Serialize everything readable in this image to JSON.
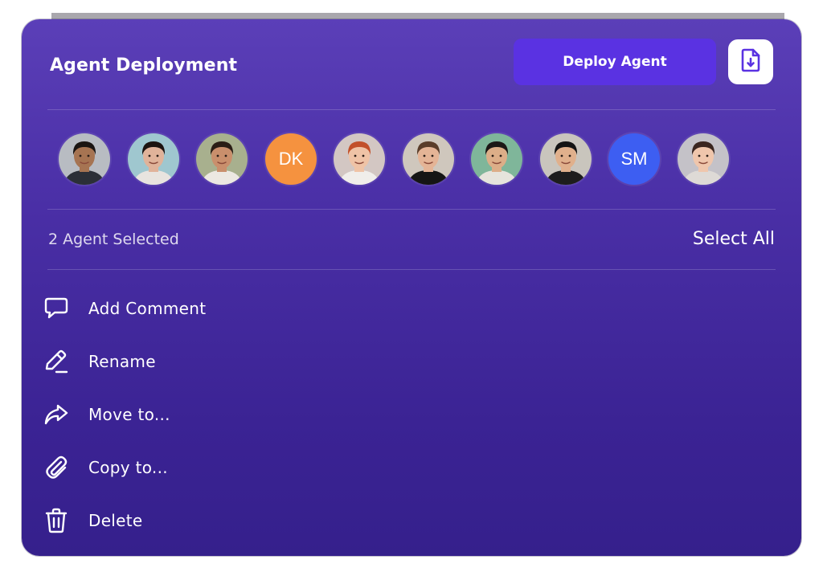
{
  "header": {
    "title": "Agent Deployment",
    "deploy_label": "Deploy Agent",
    "download_icon": "file-download-icon"
  },
  "agents": [
    {
      "type": "photo",
      "name_icon": "agent-avatar-1",
      "skin": "#a67452",
      "hair": "#1a1512",
      "bg": "#b8bcc2",
      "shirt": "#2b2f37"
    },
    {
      "type": "photo",
      "name_icon": "agent-avatar-2",
      "skin": "#e0b39a",
      "hair": "#1c1410",
      "bg": "#9fc7cf",
      "shirt": "#e8e4df"
    },
    {
      "type": "photo",
      "name_icon": "agent-avatar-3",
      "skin": "#c98f6c",
      "hair": "#2a1d15",
      "bg": "#a8b08e",
      "shirt": "#ece8e2"
    },
    {
      "type": "initials",
      "initials": "DK",
      "color": "#f5923f"
    },
    {
      "type": "photo",
      "name_icon": "agent-avatar-5",
      "skin": "#efc3a6",
      "hair": "#c2502a",
      "bg": "#d3c7c3",
      "shirt": "#f0eeea"
    },
    {
      "type": "photo",
      "name_icon": "agent-avatar-6",
      "skin": "#e4b496",
      "hair": "#5a3d2a",
      "bg": "#cfc7bd",
      "shirt": "#151515"
    },
    {
      "type": "photo",
      "name_icon": "agent-avatar-7",
      "skin": "#dcae88",
      "hair": "#1c1816",
      "bg": "#7fb69a",
      "shirt": "#e6e4dc"
    },
    {
      "type": "photo",
      "name_icon": "agent-avatar-8",
      "skin": "#e0b08c",
      "hair": "#141414",
      "bg": "#c9c5bd",
      "shirt": "#1d1d1d"
    },
    {
      "type": "initials",
      "initials": "SM",
      "color": "#3d5ef2"
    },
    {
      "type": "photo",
      "name_icon": "agent-avatar-10",
      "skin": "#efc6ac",
      "hair": "#3a2620",
      "bg": "#c4c2c8",
      "shirt": "#dedad6"
    }
  ],
  "selection": {
    "count_text": "2 Agent Selected",
    "select_all_label": "Select All"
  },
  "menu": [
    {
      "label": "Add Comment",
      "icon": "comment-icon"
    },
    {
      "label": "Rename",
      "icon": "pencil-icon"
    },
    {
      "label": "Move to...",
      "icon": "share-arrow-icon"
    },
    {
      "label": "Copy to...",
      "icon": "paperclip-icon"
    },
    {
      "label": "Delete",
      "icon": "trash-icon"
    }
  ],
  "colors": {
    "accent": "#5a32e2",
    "card_top": "#5b3fb8",
    "card_bottom": "#35208c"
  }
}
